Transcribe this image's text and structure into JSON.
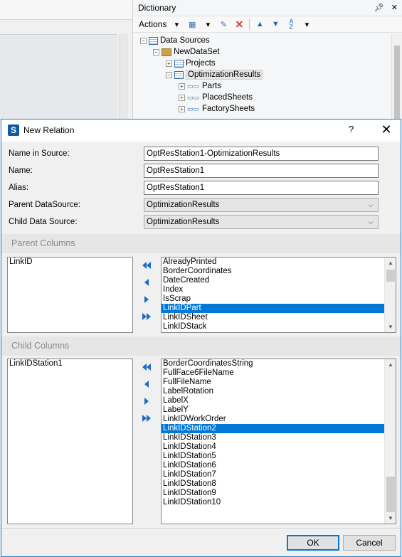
{
  "dictionary": {
    "title": "Dictionary",
    "pin_icon": "pin-icon",
    "close_icon": "close-icon",
    "toolbar": {
      "actions_label": "Actions"
    },
    "tree": [
      {
        "label": "Data Sources"
      },
      {
        "label": "NewDataSet"
      },
      {
        "label": "Projects"
      },
      {
        "label": "OptimizationResults"
      },
      {
        "label": "Parts"
      },
      {
        "label": "PlacedSheets"
      },
      {
        "label": "FactorySheets"
      }
    ]
  },
  "dialog": {
    "title": "New Relation",
    "help": "?",
    "close": "✕",
    "fields": {
      "name_in_source_label": "Name in Source:",
      "name_in_source_value": "OptResStation1-OptimizationResults",
      "name_label": "Name:",
      "name_value": "OptResStation1",
      "alias_label": "Alias:",
      "alias_value": "OptResStation1",
      "parent_ds_label": "Parent DataSource:",
      "parent_ds_value": "OptimizationResults",
      "child_ds_label": "Child Data Source:",
      "child_ds_value": "OptimizationResults"
    },
    "parent_columns": {
      "header": "Parent Columns",
      "selected": [
        "LinkID"
      ],
      "available": [
        "AlreadyPrinted",
        "BorderCoordinates",
        "DateCreated",
        "Index",
        "IsScrap",
        "LinkIDPart",
        "LinkIDSheet",
        "LinkIDStack"
      ],
      "available_selected_index": 5
    },
    "child_columns": {
      "header": "Child Columns",
      "selected": [
        "LinkIDStation1"
      ],
      "available": [
        "BorderCoordinatesString",
        "FullFace6FileName",
        "FullFileName",
        "LabelRotation",
        "LabelX",
        "LabelY",
        "LinkIDWorkOrder",
        "LinkIDStation2",
        "LinkIDStation3",
        "LinkIDStation4",
        "LinkIDStation5",
        "LinkIDStation6",
        "LinkIDStation7",
        "LinkIDStation8",
        "LinkIDStation9",
        "LinkIDStation10"
      ],
      "available_selected_index": 7
    },
    "buttons": {
      "ok": "OK",
      "cancel": "Cancel"
    },
    "colors": {
      "accent": "#0078d7",
      "arrow": "#1a6cc4"
    }
  }
}
